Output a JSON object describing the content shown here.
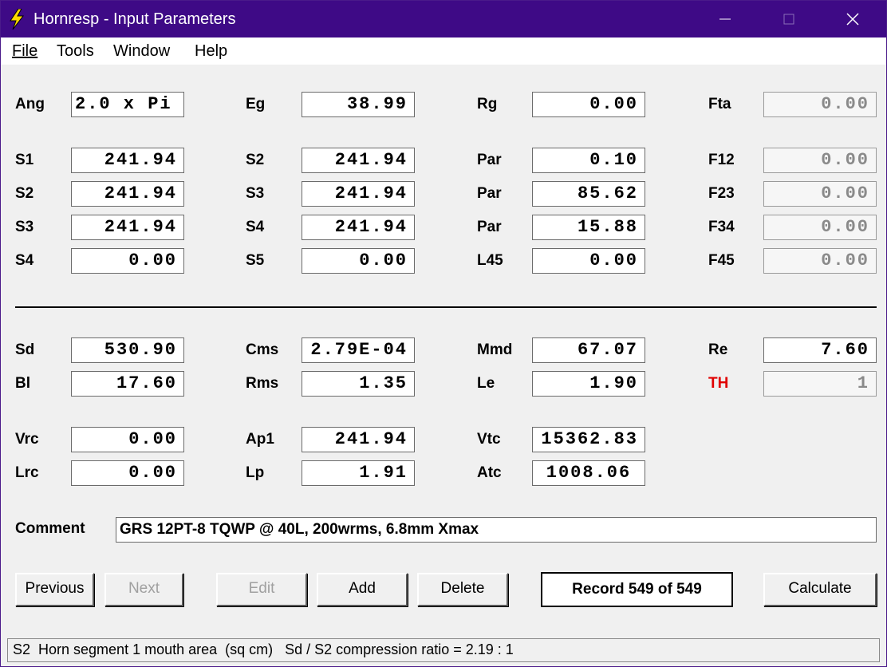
{
  "window": {
    "title": "Hornresp - Input Parameters",
    "title_bar_color": "#3e0a86",
    "icon": "lightning-bolt-icon"
  },
  "menu": [
    "File",
    "Tools",
    "Window",
    "Help"
  ],
  "params": {
    "ang": {
      "label": "Ang",
      "value": "2.0 x Pi"
    },
    "eg": {
      "label": "Eg",
      "value": "38.99"
    },
    "rg": {
      "label": "Rg",
      "value": "0.00"
    },
    "fta": {
      "label": "Fta",
      "value": "0.00"
    },
    "s1": {
      "label": "S1",
      "value": "241.94"
    },
    "s2a": {
      "label": "S2",
      "value": "241.94"
    },
    "par1": {
      "label": "Par",
      "value": "0.10"
    },
    "f12": {
      "label": "F12",
      "value": "0.00"
    },
    "s2b": {
      "label": "S2",
      "value": "241.94"
    },
    "s3a": {
      "label": "S3",
      "value": "241.94"
    },
    "par2": {
      "label": "Par",
      "value": "85.62"
    },
    "f23": {
      "label": "F23",
      "value": "0.00"
    },
    "s3b": {
      "label": "S3",
      "value": "241.94"
    },
    "s4a": {
      "label": "S4",
      "value": "241.94"
    },
    "par3": {
      "label": "Par",
      "value": "15.88"
    },
    "f34": {
      "label": "F34",
      "value": "0.00"
    },
    "s4b": {
      "label": "S4",
      "value": "0.00"
    },
    "s5": {
      "label": "S5",
      "value": "0.00"
    },
    "l45": {
      "label": "L45",
      "value": "0.00"
    },
    "f45": {
      "label": "F45",
      "value": "0.00"
    },
    "sd": {
      "label": "Sd",
      "value": "530.90"
    },
    "cms": {
      "label": "Cms",
      "value": "2.79E-04"
    },
    "mmd": {
      "label": "Mmd",
      "value": "67.07"
    },
    "re": {
      "label": "Re",
      "value": "7.60"
    },
    "bl": {
      "label": "Bl",
      "value": "17.60"
    },
    "rms": {
      "label": "Rms",
      "value": "1.35"
    },
    "le": {
      "label": "Le",
      "value": "1.90"
    },
    "th": {
      "label": "TH",
      "value": "1"
    },
    "vrc": {
      "label": "Vrc",
      "value": "0.00"
    },
    "ap1": {
      "label": "Ap1",
      "value": "241.94"
    },
    "vtc": {
      "label": "Vtc",
      "value": "15362.83"
    },
    "lrc": {
      "label": "Lrc",
      "value": "0.00"
    },
    "lp": {
      "label": "Lp",
      "value": "1.91"
    },
    "atc": {
      "label": "Atc",
      "value": "1008.06"
    }
  },
  "comment": {
    "label": "Comment",
    "value": "GRS 12PT-8 TQWP @ 40L, 200wrms, 6.8mm Xmax"
  },
  "buttons": {
    "previous": "Previous",
    "next": "Next",
    "edit": "Edit",
    "add": "Add",
    "delete": "Delete",
    "calculate": "Calculate"
  },
  "record": "Record 549 of 549",
  "status": "S2  Horn segment 1 mouth area  (sq cm)   Sd / S2 compression ratio = 2.19 : 1",
  "colors": {
    "th_label": "#e00000"
  }
}
